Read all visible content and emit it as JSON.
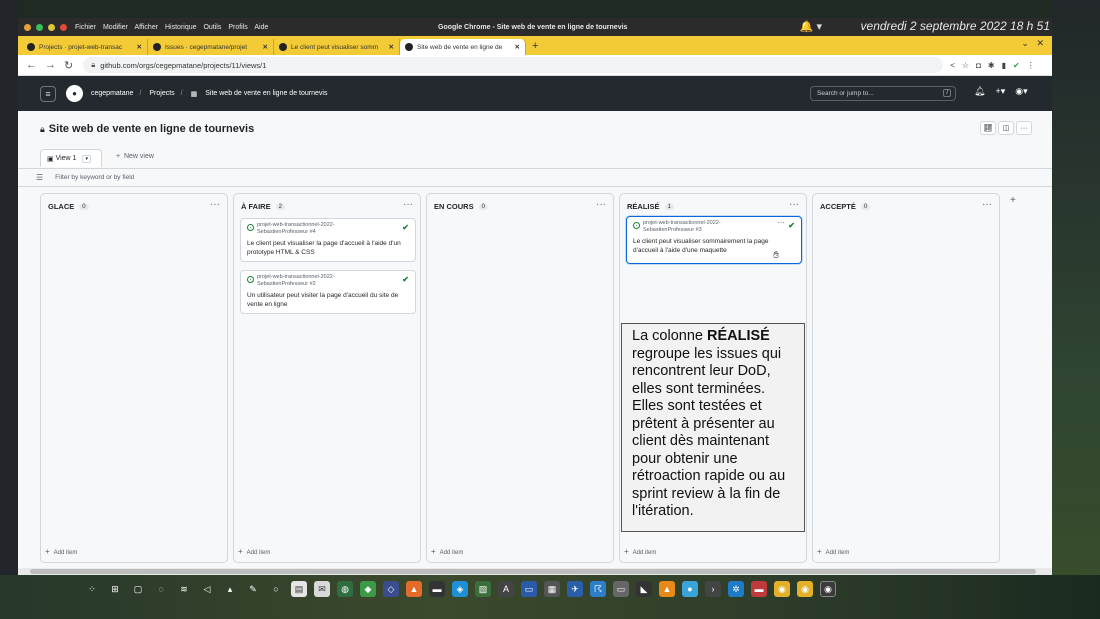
{
  "os": {
    "menu": [
      "Fichier",
      "Modifier",
      "Afficher",
      "Historique",
      "Outils",
      "Profils",
      "Aide"
    ],
    "window_title": "Google Chrome - Site web de vente en ligne de tournevis",
    "clock": "vendredi 2 septembre 2022  18 h 51"
  },
  "tabs": [
    {
      "label": "Projects · projet-web-transac",
      "active": false
    },
    {
      "label": "Issues · cegepmatane/projet",
      "active": false
    },
    {
      "label": "Le client peut visualiser somm",
      "active": false
    },
    {
      "label": "Site web de vente en ligne de",
      "active": true
    }
  ],
  "address": {
    "url": "github.com/orgs/cegepmatane/projects/11/views/1"
  },
  "github": {
    "org": "cegepmatane",
    "projects_crumb": "Projects",
    "project_crumb": "Site web de vente en ligne de tournevis",
    "search_placeholder": "Search or jump to...",
    "search_key": "/"
  },
  "project": {
    "title": "Site web de vente en ligne de tournevis",
    "view_label": "View 1",
    "new_view": "New view",
    "filter_placeholder": "Filter by keyword or by field",
    "add_item": "Add item"
  },
  "columns": [
    {
      "name": "GLACE",
      "count": "0",
      "cards": []
    },
    {
      "name": "À FAIRE",
      "count": "2",
      "cards": [
        {
          "repo": "projet-web-transactionnel-2022-SebastienProfesseur #4",
          "title": "Le client peut visualiser la page d'accueil à l'aide d'un prototype HTML & CSS"
        },
        {
          "repo": "projet-web-transactionnel-2022-SebastienProfesseur #2",
          "title": "Un utilisateur peut visiter la page d'accueil du site de vente en ligne"
        }
      ]
    },
    {
      "name": "EN COURS",
      "count": "0",
      "cards": []
    },
    {
      "name": "RÉALISÉ",
      "count": "1",
      "cards": [
        {
          "repo": "projet-web-transactionnel-2022-SebastienProfesseur #3",
          "title": "Le client peut visualiser sommairement la page d'accueil à l'aide d'une maquette"
        }
      ]
    },
    {
      "name": "ACCEPTÉ",
      "count": "0",
      "cards": []
    }
  ],
  "callout": {
    "pre": "La colonne ",
    "bold": "RÉALISÉ",
    "post": " regroupe les issues qui rencontrent leur DoD, elles sont terminées. Elles sont testées et prêtent à présenter au client dès maintenant pour obtenir une rétroaction rapide ou au sprint review à la fin de l'itération."
  },
  "colors": {
    "gh_header": "#24292f",
    "tabstrip": "#f3cb37",
    "open_issue": "#1a7f37",
    "selected_border": "#0969da"
  }
}
